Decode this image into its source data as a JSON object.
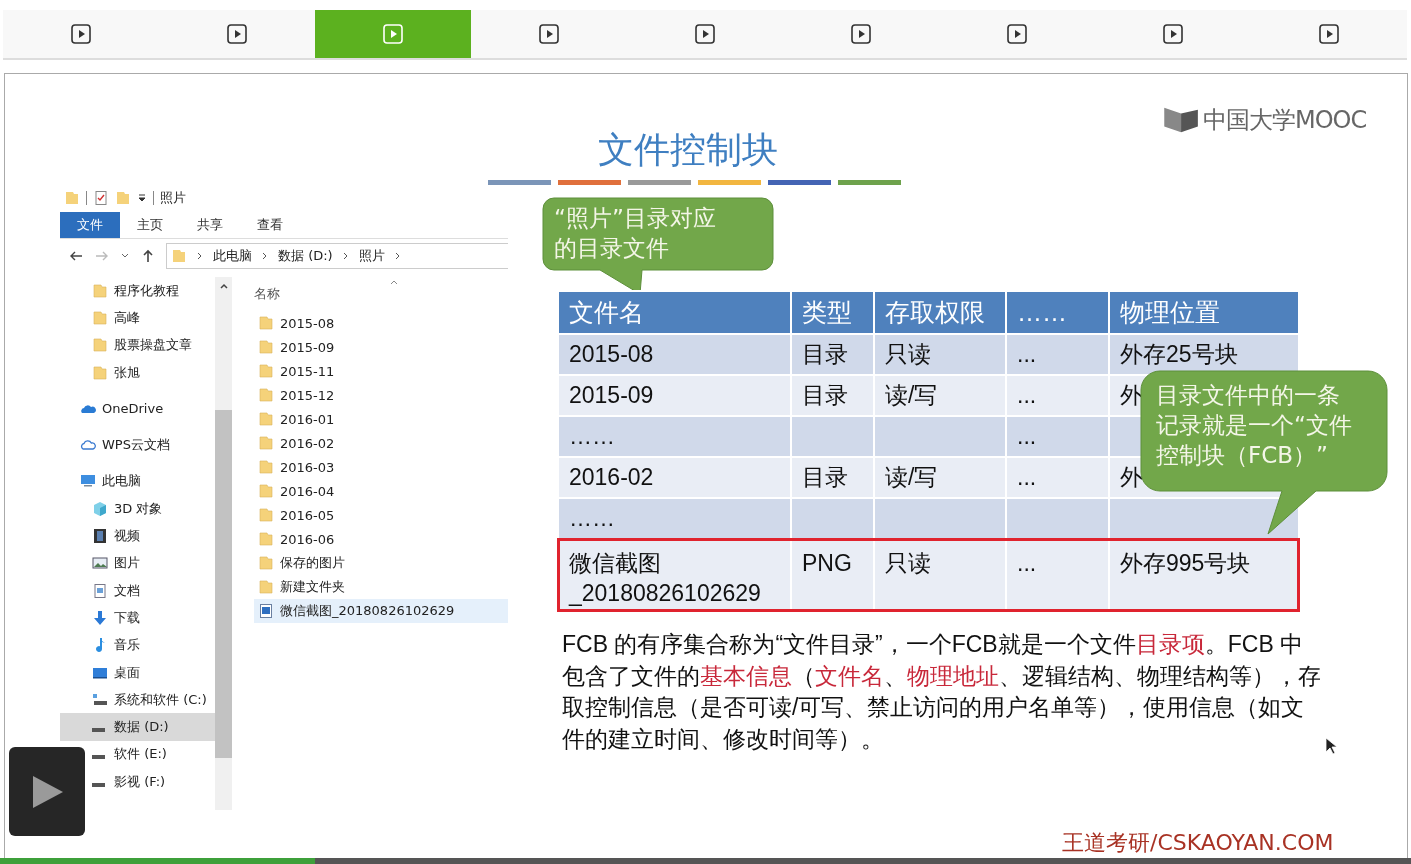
{
  "slide_nav": [
    {
      "selected": false
    },
    {
      "selected": false
    },
    {
      "selected": true
    },
    {
      "selected": false
    },
    {
      "selected": false
    },
    {
      "selected": false
    },
    {
      "selected": false
    },
    {
      "selected": false
    },
    {
      "selected": false
    }
  ],
  "slide": {
    "logo": "中国大学MOOC",
    "title": "文件控制块",
    "explorer": {
      "title": "照片",
      "ribbon_tabs": [
        {
          "label": "文件",
          "selected": true
        },
        {
          "label": "主页",
          "selected": false
        },
        {
          "label": "共享",
          "selected": false
        },
        {
          "label": "查看",
          "selected": false
        }
      ],
      "breadcrumb": [
        "此电脑",
        "数据 (D:)",
        "照片"
      ],
      "pinned": [
        {
          "label": "程序化教程",
          "kind": "folder",
          "selected": false
        },
        {
          "label": "高峰",
          "kind": "folder",
          "selected": false
        },
        {
          "label": "股票操盘文章",
          "kind": "folder",
          "selected": false
        },
        {
          "label": "张旭",
          "kind": "folder",
          "selected": false
        }
      ],
      "locations": [
        {
          "label": "OneDrive",
          "kind": "onedrive",
          "selected": false
        },
        {
          "label": "WPS云文档",
          "kind": "cloud",
          "selected": false
        },
        {
          "label": "此电脑",
          "kind": "pc",
          "selected": false,
          "children": [
            {
              "label": "3D 对象",
              "kind": "cube",
              "selected": false
            },
            {
              "label": "视频",
              "kind": "film",
              "selected": false
            },
            {
              "label": "图片",
              "kind": "pictures",
              "selected": false
            },
            {
              "label": "文档",
              "kind": "document",
              "selected": false
            },
            {
              "label": "下载",
              "kind": "download",
              "selected": false
            },
            {
              "label": "音乐",
              "kind": "music",
              "selected": false
            },
            {
              "label": "桌面",
              "kind": "desktop",
              "selected": false
            },
            {
              "label": "系统和软件 (C:)",
              "kind": "system-drive",
              "selected": false
            },
            {
              "label": "数据 (D:)",
              "kind": "drive",
              "selected": true
            },
            {
              "label": "软件 (E:)",
              "kind": "drive",
              "selected": false
            },
            {
              "label": "影视 (F:)",
              "kind": "drive",
              "selected": false
            }
          ]
        }
      ],
      "column_header": "名称",
      "files": [
        {
          "name": "2015-08",
          "kind": "folder",
          "selected": false
        },
        {
          "name": "2015-09",
          "kind": "folder",
          "selected": false
        },
        {
          "name": "2015-11",
          "kind": "folder",
          "selected": false
        },
        {
          "name": "2015-12",
          "kind": "folder",
          "selected": false
        },
        {
          "name": "2016-01",
          "kind": "folder",
          "selected": false
        },
        {
          "name": "2016-02",
          "kind": "folder",
          "selected": false
        },
        {
          "name": "2016-03",
          "kind": "folder",
          "selected": false
        },
        {
          "name": "2016-04",
          "kind": "folder",
          "selected": false
        },
        {
          "name": "2016-05",
          "kind": "folder",
          "selected": false
        },
        {
          "name": "2016-06",
          "kind": "folder",
          "selected": false
        },
        {
          "name": "保存的图片",
          "kind": "folder",
          "selected": false
        },
        {
          "name": "新建文件夹",
          "kind": "folder",
          "selected": false
        },
        {
          "name": "微信截图_20180826102629",
          "kind": "image",
          "selected": true
        }
      ]
    },
    "callout_top": "“照片”目录对应的目录文件",
    "table": {
      "columns": [
        "文件名",
        "类型",
        "存取权限",
        "……",
        "物理位置"
      ],
      "rows": [
        {
          "cells": [
            "2015-08",
            "目录",
            "只读",
            "...",
            "外存25号块"
          ],
          "highlighted": false
        },
        {
          "cells": [
            "2015-09",
            "目录",
            "读/写",
            "...",
            "外"
          ],
          "highlighted": false
        },
        {
          "cells": [
            "……",
            "",
            "",
            "...",
            ""
          ],
          "highlighted": false
        },
        {
          "cells": [
            "2016-02",
            "目录",
            "读/写",
            "...",
            "外"
          ],
          "highlighted": false
        },
        {
          "cells": [
            "……",
            "",
            "",
            "",
            ""
          ],
          "highlighted": false
        },
        {
          "cells": [
            "微信截图_20180826102629",
            "PNG",
            "只读",
            "...",
            "外存995号块"
          ],
          "highlighted": true
        }
      ]
    },
    "callout_right": "目录文件中的一条记录就是一个“文件控制块（FCB）”",
    "paragraph": "FCB 的有序集合称为“文件目录”，一个FCB就是一个文件**目录项**。FCB 中包含了文件的**基本信息**（**文件名**、**物理地址**、逻辑结构、物理结构等），存取控制信息（是否可读/可写、禁止访问的用户名单等），使用信息（如文件的建立时间、修改时间等）。",
    "footer": "王道考研/CSKAOYAN.COM"
  },
  "player": {
    "progress": {
      "level": 0.223
    }
  }
}
